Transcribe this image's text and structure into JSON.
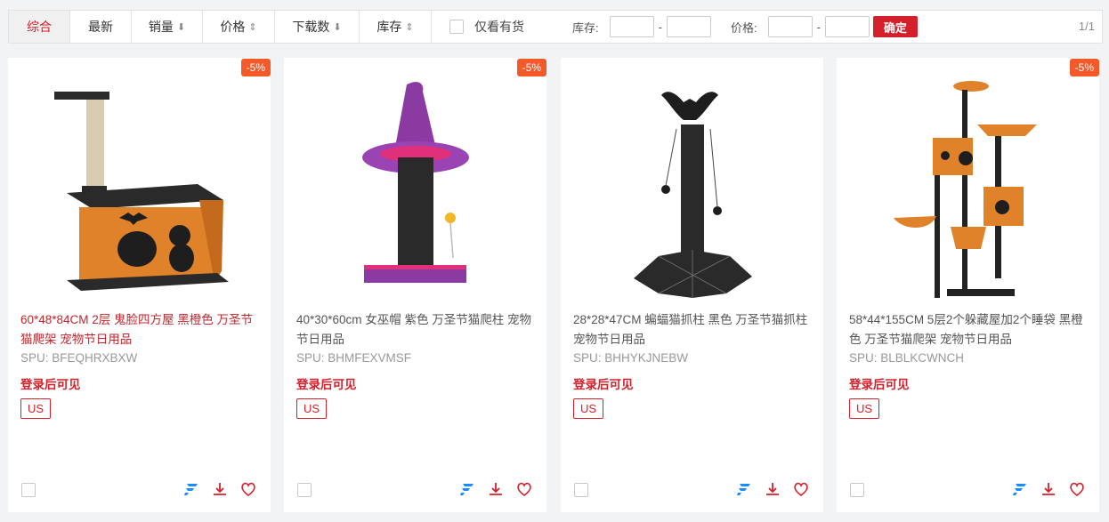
{
  "toolbar": {
    "sort_tabs": [
      {
        "label": "综合",
        "arrow": ""
      },
      {
        "label": "最新",
        "arrow": ""
      },
      {
        "label": "销量",
        "arrow": "⬇"
      },
      {
        "label": "价格",
        "arrow": "⇕"
      },
      {
        "label": "下载数",
        "arrow": "⬇"
      },
      {
        "label": "库存",
        "arrow": "⇕"
      }
    ],
    "stock_only_label": "仅看有货",
    "stock_range_label": "库存:",
    "price_range_label": "价格:",
    "range_dash": "-",
    "confirm_label": "确定",
    "page_indicator": "1/1"
  },
  "products": [
    {
      "discount": "-5%",
      "title": "60*48*84CM 2层 鬼脸四方屋 黑橙色 万圣节猫爬架 宠物节日用品",
      "spu": "SPU:  BFEQHRXBXW",
      "price_note": "登录后可见",
      "region": "US",
      "icon": "cat-house-image"
    },
    {
      "discount": "-5%",
      "title": "40*30*60cm 女巫帽 紫色 万圣节猫爬柱 宠物节日用品",
      "spu": "SPU:  BHMFEXVMSF",
      "price_note": "登录后可见",
      "region": "US",
      "icon": "witch-hat-scratcher-image"
    },
    {
      "discount": "-5%",
      "title": "28*28*47CM 蝙蝠猫抓柱 黑色 万圣节猫抓柱 宠物节日用品",
      "spu": "SPU:  BHHYKJNEBW",
      "price_note": "登录后可见",
      "region": "US",
      "icon": "bat-scratcher-image"
    },
    {
      "discount": "-5%",
      "title": "58*44*155CM 5层2个躲藏屋加2个睡袋 黑橙色 万圣节猫爬架 宠物节日用品",
      "spu": "SPU:  BLBLKCWNCH",
      "price_note": "登录后可见",
      "region": "US",
      "icon": "cat-tree-image"
    }
  ],
  "colors": {
    "accent": "#d4202a",
    "discount": "#f4592a",
    "brand_icon": "#1a8cff"
  }
}
